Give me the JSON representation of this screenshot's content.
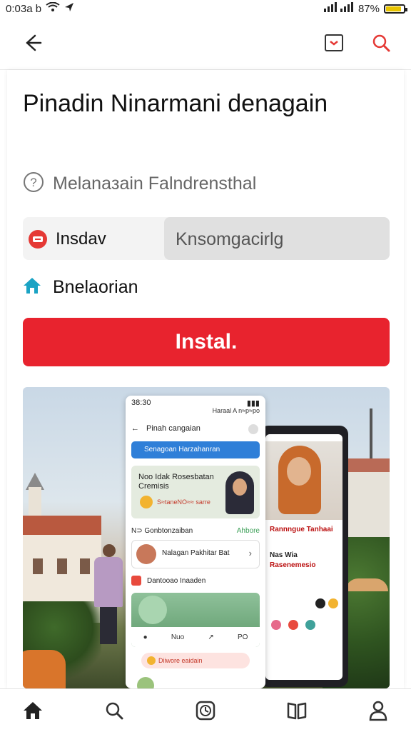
{
  "status_bar": {
    "time": "0:03a b",
    "battery": "87%",
    "battery_level": 0.87,
    "icons": [
      "wifi-icon",
      "location-arrow-icon",
      "signal-icon",
      "battery-icon"
    ]
  },
  "app_bar": {
    "icons": [
      "back-arrow-icon",
      "bookmark-icon",
      "search-icon"
    ]
  },
  "app": {
    "title": "Pinadin Ninarmani denagain",
    "subtitle": "Melanaзain Falndrensthal",
    "developer": "Insdav",
    "category": "Knsomgacirlg",
    "home_label": "Bnelaorian",
    "install_label": "Instal."
  },
  "preview": {
    "phone": {
      "time": "38:30",
      "sub_status": "Haraal A n≈p≈po",
      "header_title": "Pinah cangaian",
      "banner": "Senagoan Harzahanran",
      "promo_title": "Noo Idak Rosesbatan",
      "promo_subtitle": "Cremisis",
      "promo_note": "S≈taneNO≈≈ sarre",
      "section_title": "N⊃ Gonbtonzaiban",
      "section_link": "Ahbore",
      "item_text": "Nalagan Pakhitar Bat",
      "row2_text": "Dantooao Inaaden",
      "card_tab_1": "Nuo",
      "card_tab_2": "PO",
      "pill_text": "Diiwore eaidain"
    },
    "back_phone": {
      "lines": [
        "Rannngue Tanhaai",
        "Nas Wia",
        "Rasenemesio"
      ]
    }
  },
  "bottom_nav": {
    "items": [
      "home-icon",
      "search-icon",
      "history-icon",
      "library-icon",
      "profile-icon"
    ]
  },
  "colors": {
    "accent": "#e8232e",
    "developer_badge": "#e53935",
    "home_icon": "#1aa3c4",
    "pill_gray": "#e0e0e0"
  }
}
